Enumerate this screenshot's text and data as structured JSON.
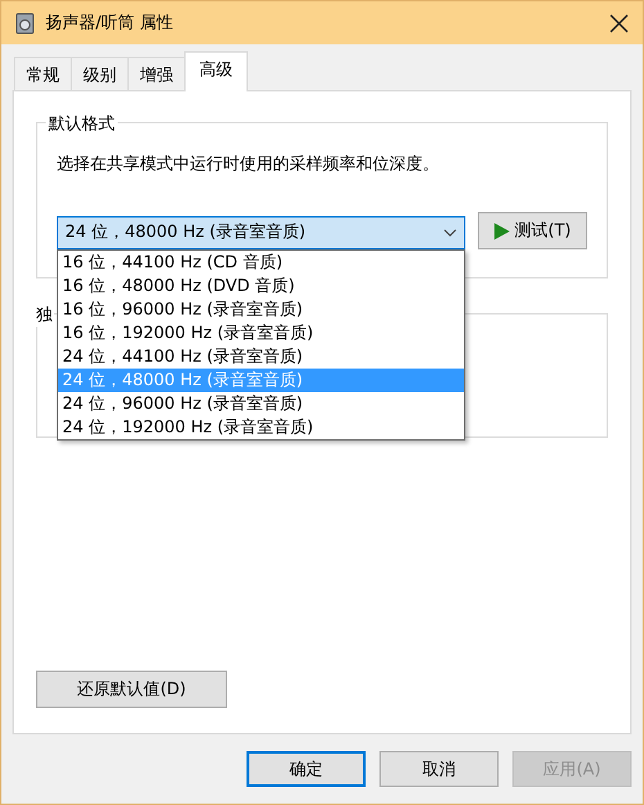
{
  "window": {
    "title": "扬声器/听筒 属性"
  },
  "tabs": [
    {
      "label": "常规",
      "selected": false
    },
    {
      "label": "级别",
      "selected": false
    },
    {
      "label": "增强",
      "selected": false
    },
    {
      "label": "高级",
      "selected": true
    }
  ],
  "default_format": {
    "title": "默认格式",
    "description": "选择在共享模式中运行时使用的采样频率和位深度。",
    "select": {
      "value": "24 位，48000 Hz (录音室音质)",
      "expanded": true
    },
    "options": [
      {
        "label": "16 位，44100 Hz (CD 音质)",
        "selected": false
      },
      {
        "label": "16 位，48000 Hz (DVD 音质)",
        "selected": false
      },
      {
        "label": "16 位，96000 Hz (录音室音质)",
        "selected": false
      },
      {
        "label": "16 位，192000 Hz (录音室音质)",
        "selected": false
      },
      {
        "label": "24 位，44100 Hz (录音室音质)",
        "selected": false
      },
      {
        "label": "24 位，48000 Hz (录音室音质)",
        "selected": true
      },
      {
        "label": "24 位，96000 Hz (录音室音质)",
        "selected": false
      },
      {
        "label": "24 位，192000 Hz (录音室音质)",
        "selected": false
      }
    ],
    "test_button": "测试(T)"
  },
  "exclusive_group": {
    "title": "独"
  },
  "restore_button": "还原默认值(D)",
  "buttons": [
    {
      "label": "确定",
      "default": true,
      "disabled": false
    },
    {
      "label": "取消",
      "default": false,
      "disabled": false
    },
    {
      "label": "应用(A)",
      "default": false,
      "disabled": true
    }
  ]
}
